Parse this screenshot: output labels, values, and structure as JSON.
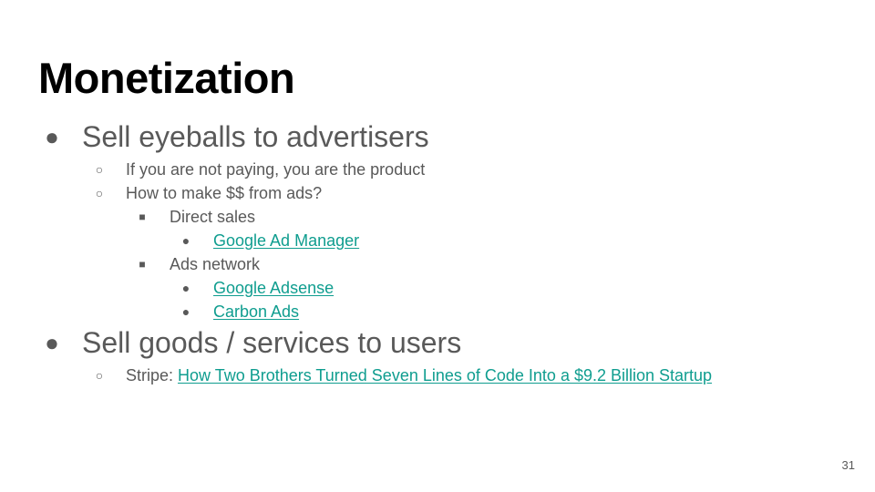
{
  "slide": {
    "title": "Monetization",
    "page_number": "31",
    "link_color": "#0f9d8f",
    "text_color": "#595959",
    "bullets": {
      "level1": "●",
      "level2": "○",
      "level3": "■",
      "level4": "●"
    },
    "items": {
      "sell_eyeballs": "Sell eyeballs to advertisers",
      "not_paying": "If you are not paying, you are the product",
      "make_money_ads": "How to make $$ from ads?",
      "direct_sales": "Direct sales",
      "google_ad_manager": "Google Ad Manager",
      "ads_network": "Ads network",
      "google_adsense": "Google Adsense",
      "carbon_ads": "Carbon Ads",
      "sell_goods": "Sell goods / services to users",
      "stripe_prefix": "Stripe: ",
      "stripe_link": "How Two Brothers Turned Seven Lines of Code Into a $9.2 Billion Startup"
    }
  }
}
